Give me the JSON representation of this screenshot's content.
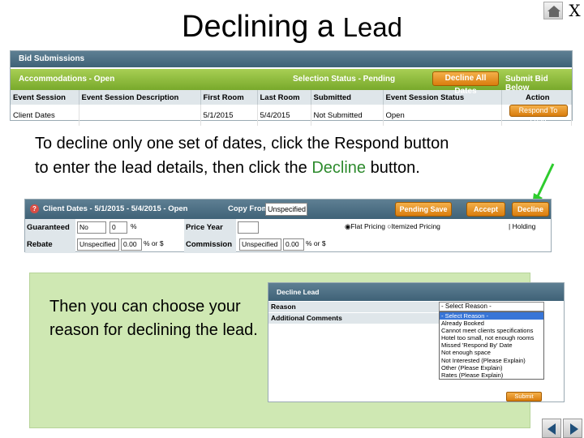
{
  "title": {
    "part1": "Declining a ",
    "part2": "Lead"
  },
  "window": {
    "close_label": "X"
  },
  "bid_panel": {
    "header": "Bid Submissions",
    "accom_label": "Accommodations -  Open",
    "selection_label": "Selection Status -  Pending",
    "decline_all_label": "Decline All Dates",
    "submit_bid_label": "Submit Bid Below",
    "columns": [
      "Event Session",
      "Event Session Description",
      "First Room",
      "Last Room",
      "Submitted",
      "Event Session Status",
      "Action"
    ],
    "row": [
      "Client Dates",
      "",
      "5/1/2015",
      "5/4/2015",
      "Not Submitted",
      "Open"
    ],
    "respond_label": "Respond To Lead"
  },
  "instruction": {
    "line1": "To decline only one set of dates, click the Respond button",
    "line2_a": "to enter the lead details, then click the ",
    "line2_green": "Decline",
    "line2_b": " button."
  },
  "client_panel": {
    "title": "Client Dates - 5/1/2015 - 5/4/2015 - Open",
    "copy_from_label": "Copy From:",
    "copy_from_value": "Unspecified",
    "pending_save_label": "Pending Save",
    "accept_label": "Accept",
    "decline_label": "Decline",
    "guaranteed_label": "Guaranteed",
    "guaranteed_value": "No",
    "guaranteed_num": "0",
    "pct": "%",
    "price_year_label": "Price Year",
    "flat_pricing": "Flat Pricing",
    "itemized_pricing": "Itemized Pricing",
    "holding": "Holding",
    "rebate_label": "Rebate",
    "rebate_value": "Unspecified",
    "rebate_num": "0.00",
    "pct_or_s": "% or $",
    "commission_label": "Commission",
    "commission_value": "Unspecified",
    "commission_num": "0.00"
  },
  "green_text": "Then you can choose your reason for declining the lead.",
  "decline_panel": {
    "header": "Decline Lead",
    "reason_label": "Reason",
    "additional_label": "Additional Comments",
    "select_value": "- Select Reason -",
    "options": [
      "- Select Reason -",
      "Already Booked",
      "Cannot meet clients specifications",
      "Hotel too small, not enough rooms",
      "Missed 'Respond By' Date",
      "Not enough space",
      "Not Interested (Please Explain)",
      "Other (Please Explain)",
      "Rates (Please Explain)"
    ],
    "submit_label": "Submit"
  }
}
